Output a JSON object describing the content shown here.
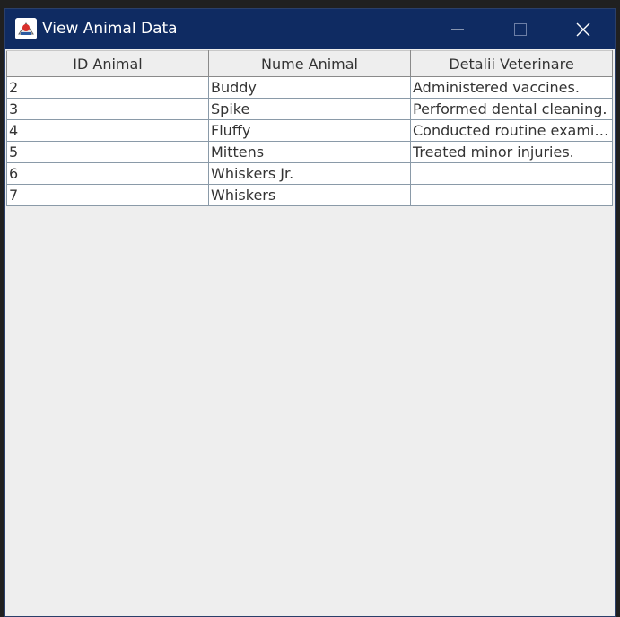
{
  "window": {
    "title": "View Animal Data",
    "icon": "java-app-icon",
    "titlebar_color": "#0f2b62",
    "controls": [
      "minimize-icon",
      "maximize-icon",
      "close-icon"
    ]
  },
  "table": {
    "columns": [
      "ID Animal",
      "Nume Animal",
      "Detalii Veterinare"
    ],
    "rows": [
      [
        "2",
        "Buddy",
        "Administered vaccines."
      ],
      [
        "3",
        "Spike",
        "Performed dental cleaning."
      ],
      [
        "4",
        "Fluffy",
        "Conducted routine examination."
      ],
      [
        "5",
        "Mittens",
        "Treated minor injuries."
      ],
      [
        "6",
        "Whiskers Jr.",
        ""
      ],
      [
        "7",
        "Whiskers",
        ""
      ]
    ]
  }
}
